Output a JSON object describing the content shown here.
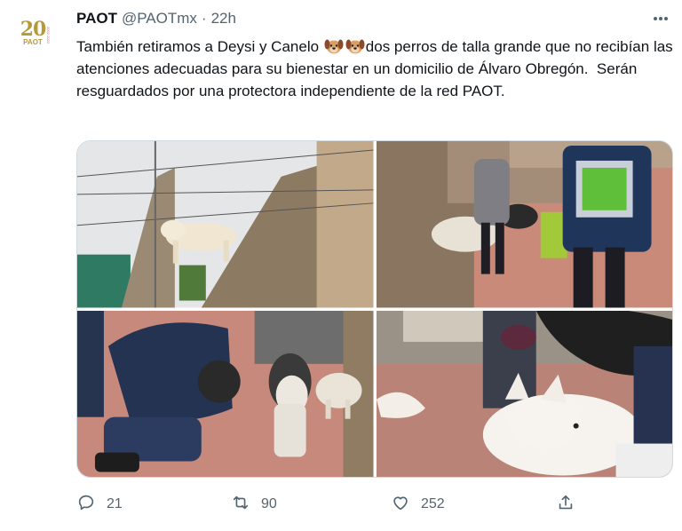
{
  "account": {
    "name": "PAOT",
    "handle": "@PAOTmx",
    "separator": "·",
    "time": "22h",
    "avatar": {
      "number": "20",
      "org": "PAOT",
      "years": "2002-2022"
    }
  },
  "tweet": {
    "text_part1": "También retiramos a Deysi y Canelo ",
    "text_part2": "dos perros de talla grande que no recibían las atenciones adecuadas para su bienestar en un domicilio de Álvaro Obregón.  Serán resguardados por una protectora independiente de la red PAOT.",
    "emoji": [
      "dog-face",
      "dog-face"
    ]
  },
  "actions": {
    "reply_count": "21",
    "retweet_count": "90",
    "like_count": "252"
  },
  "colors": {
    "text": "#0f1419",
    "secondary": "#536471",
    "border": "#cfd9de",
    "brand_gold": "#b59a3c"
  }
}
